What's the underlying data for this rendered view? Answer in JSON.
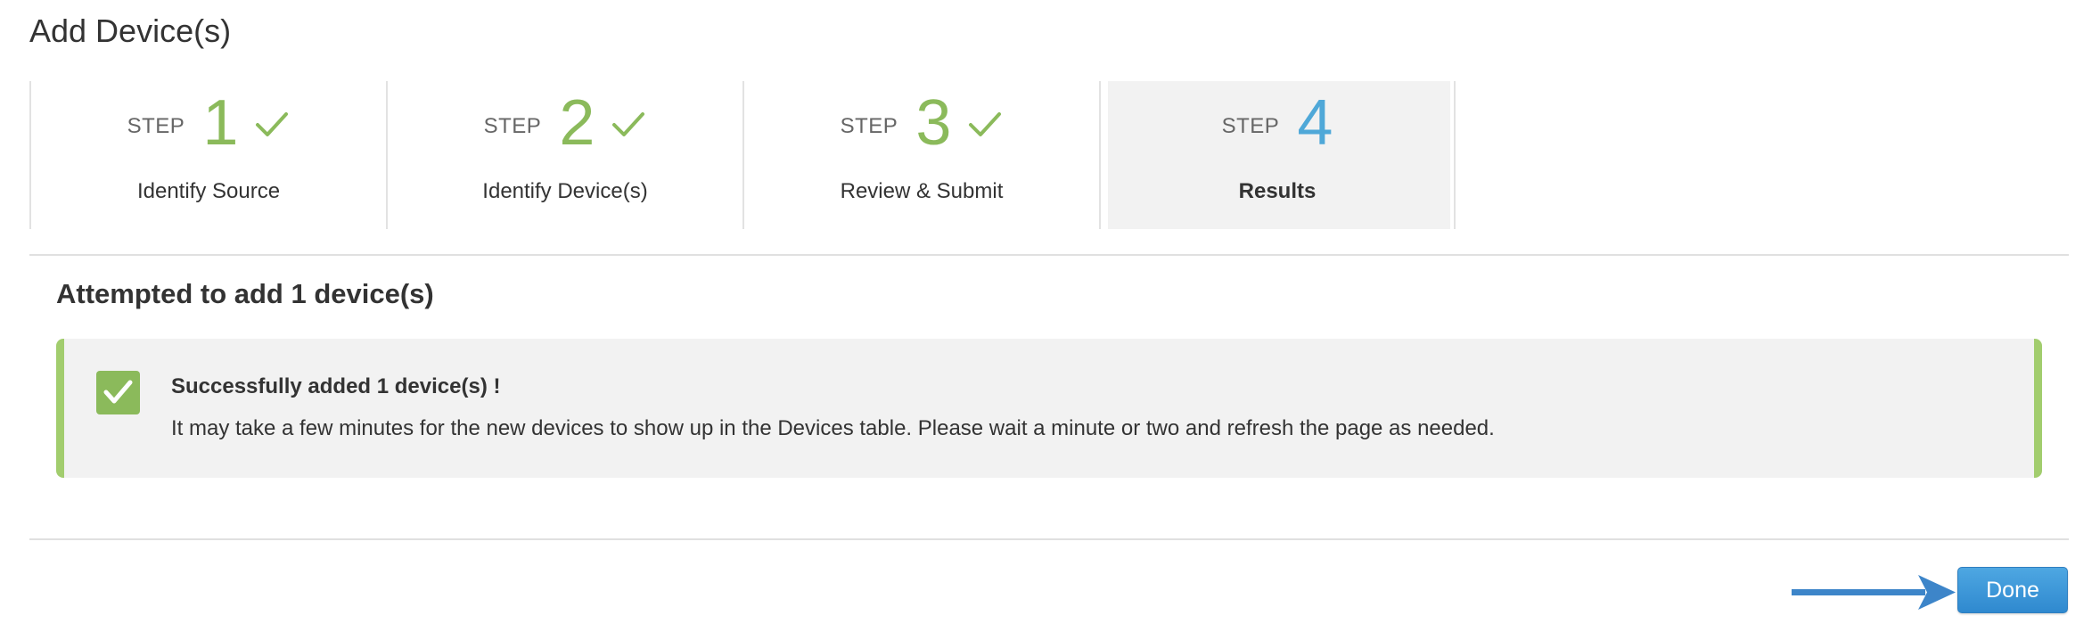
{
  "page": {
    "title": "Add Device(s)"
  },
  "wizard": {
    "steps": [
      {
        "word": "STEP",
        "number": "1",
        "label": "Identify Source",
        "completed": true,
        "active": false
      },
      {
        "word": "STEP",
        "number": "2",
        "label": "Identify Device(s)",
        "completed": true,
        "active": false
      },
      {
        "word": "STEP",
        "number": "3",
        "label": "Review & Submit",
        "completed": true,
        "active": false
      },
      {
        "word": "STEP",
        "number": "4",
        "label": "Results",
        "completed": false,
        "active": true
      }
    ]
  },
  "results": {
    "heading": "Attempted to add 1 device(s)",
    "alert": {
      "icon": "checkmark-icon",
      "title": "Successfully added 1 device(s) !",
      "message": "It may take a few minutes for the new devices to show up in the Devices table. Please wait a minute or two and refresh the page as needed."
    }
  },
  "footer": {
    "done_label": "Done",
    "arrow_icon": "arrow-right-icon"
  },
  "colors": {
    "complete_green": "#8bba5b",
    "active_blue": "#4fa8d8",
    "alert_border": "#a2cd6e",
    "button_blue": "#3a96d8",
    "arrow_blue": "#3d85c9"
  }
}
